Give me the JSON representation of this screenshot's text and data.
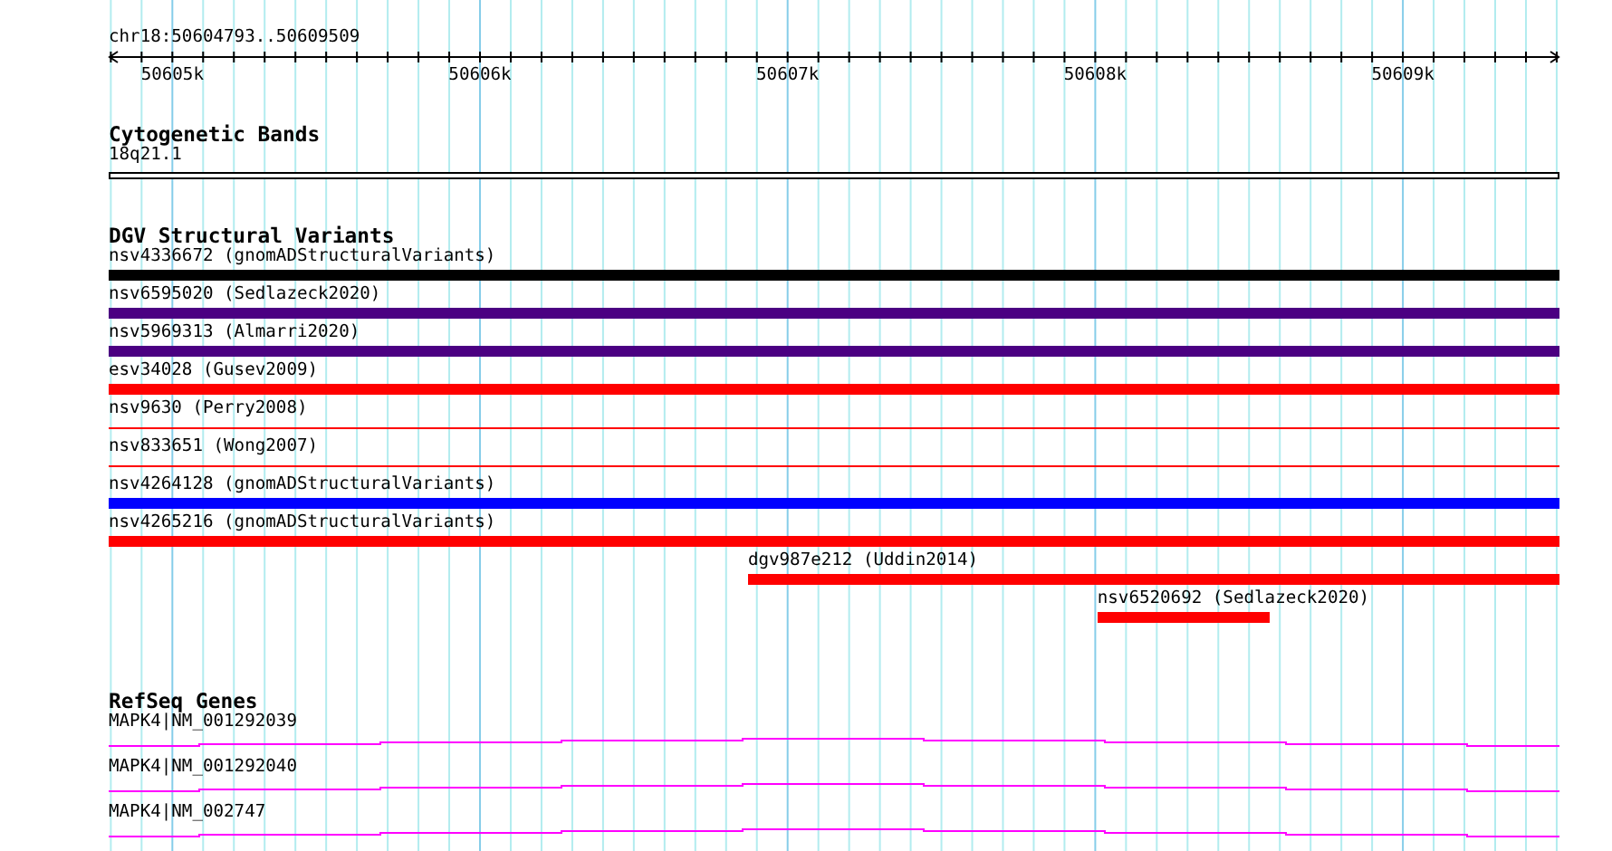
{
  "ruler": {
    "label": "chr18:50604793..50609509",
    "ticks": [
      {
        "label": "50605k"
      },
      {
        "label": "50606k"
      },
      {
        "label": "50607k"
      },
      {
        "label": "50608k"
      },
      {
        "label": "50609k"
      }
    ]
  },
  "tracks": [
    {
      "kind": "bands",
      "title": "Cytogenetic Bands",
      "features": [
        {
          "label": "18q21.1"
        }
      ]
    },
    {
      "kind": "variants",
      "title": "DGV Structural Variants",
      "features": [
        {
          "label": "nsv4336672 (gnomADStructuralVariants)",
          "kind": "thick",
          "color": "#000000"
        },
        {
          "label": "nsv6595020 (Sedlazeck2020)",
          "kind": "thick",
          "color": "#4b0082"
        },
        {
          "label": "nsv5969313 (Almarri2020)",
          "kind": "thick",
          "color": "#4b0082"
        },
        {
          "label": "esv34028 (Gusev2009)",
          "kind": "thick",
          "color": "#ff0000"
        },
        {
          "label": "nsv9630 (Perry2008)",
          "kind": "thin",
          "color": "#ff0000"
        },
        {
          "label": "nsv833651 (Wong2007)",
          "kind": "thin",
          "color": "#ff0000"
        },
        {
          "label": "nsv4264128 (gnomADStructuralVariants)",
          "kind": "thick",
          "color": "#0000ff"
        },
        {
          "label": "nsv4265216 (gnomADStructuralVariants)",
          "kind": "thick",
          "color": "#ff0000"
        },
        {
          "label": "dgv987e212 (Uddin2014)",
          "kind": "thick",
          "color": "#ff0000"
        },
        {
          "label": "nsv6520692 (Sedlazeck2020)",
          "kind": "thick",
          "color": "#ff0000"
        }
      ]
    },
    {
      "kind": "genes",
      "title": "RefSeq Genes",
      "features": [
        {
          "label": "MAPK4|NM_001292039"
        },
        {
          "label": "MAPK4|NM_001292040"
        },
        {
          "label": "MAPK4|NM_002747"
        }
      ]
    }
  ]
}
